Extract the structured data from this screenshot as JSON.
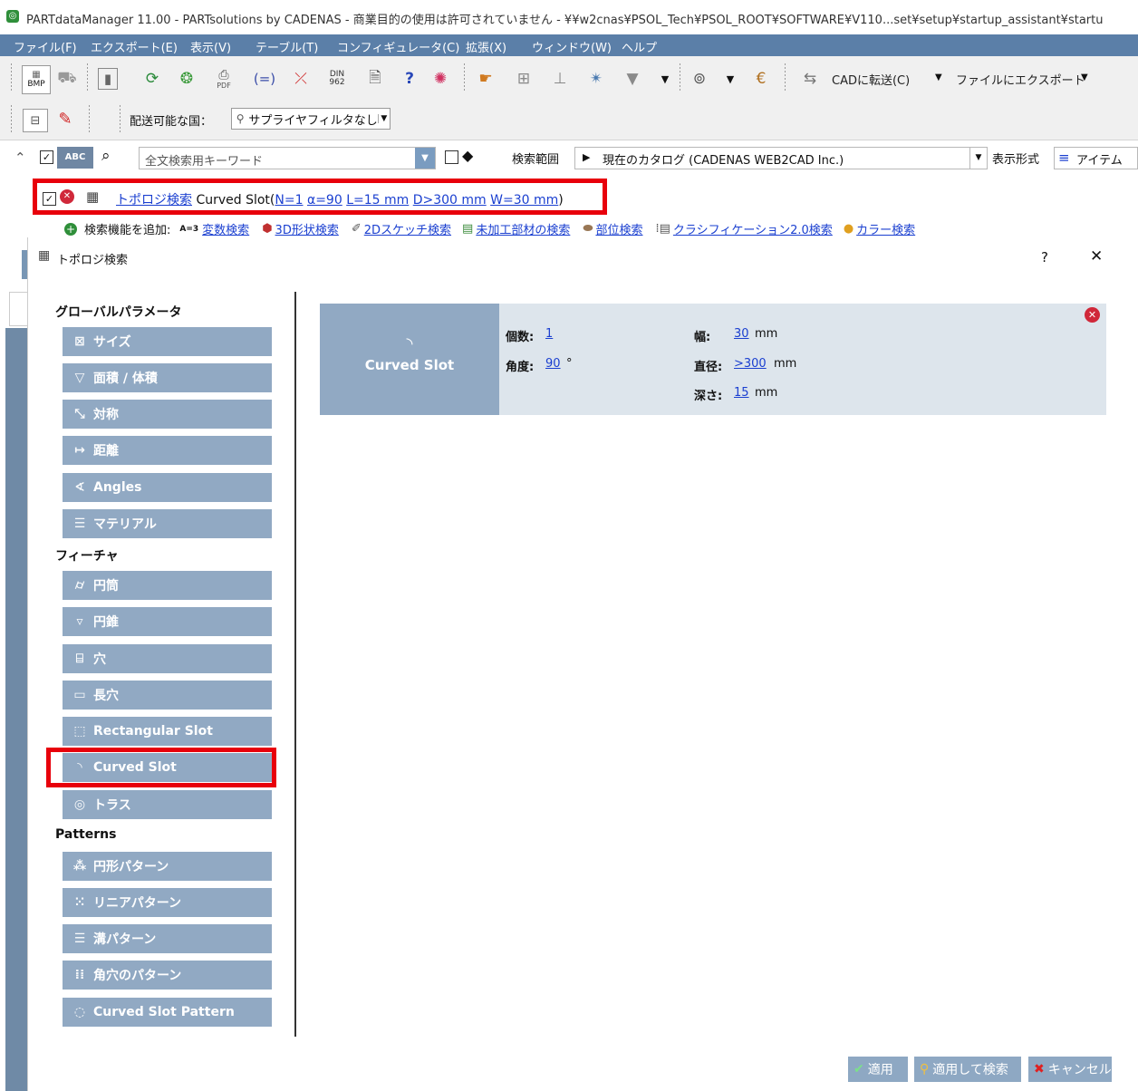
{
  "window": {
    "title": "PARTdataManager 11.00 - PARTsolutions by CADENAS - 商業目的の使用は許可されていません - ¥¥w2cnas¥PSOL_Tech¥PSOL_ROOT¥SOFTWARE¥V110...set¥setup¥startup_assistant¥startu"
  },
  "menu": [
    "ファイル(F)",
    "エクスポート(E)",
    "表示(V)",
    "テーブル(T)",
    "コンフィギュレータ(C)",
    "拡張(X)",
    "ウィンドウ(W)",
    "ヘルプ"
  ],
  "toolbar": {
    "bmp_label": "BMP",
    "pdf_label": "PDF",
    "din_label": "DIN 962",
    "cad_send": "CADに転送(C)",
    "file_export": "ファイルにエクスポート"
  },
  "filterbar": {
    "ship_label": "配送可能な国：",
    "supplier_filter": "サプライヤフィルタなし"
  },
  "search": {
    "abc_label": "ABC",
    "placeholder": "全文検索用キーワード",
    "scope_label": "検索範囲",
    "scope_value": "現在のカタログ (CADENAS WEB2CAD Inc.)",
    "view_label": "表示形式",
    "view_value": "アイテム"
  },
  "active_filter": {
    "link": "トポロジ検索",
    "feature": "Curved Slot(",
    "params": [
      "N=1",
      "α=90",
      "L=15 mm",
      "D>300 mm",
      "W=30 mm"
    ],
    "close": ")"
  },
  "add_search": {
    "label": "検索機能を追加:",
    "var_prefix": "A=3",
    "items": [
      "変数検索",
      "3D形状検索",
      "2Dスケッチ検索",
      "未加工部材の検索",
      "部位検索",
      "クラシフィケーション2.0検索",
      "カラー検索"
    ]
  },
  "dialog": {
    "title": "トポロジ検索",
    "help": "?",
    "close": "✕",
    "global_header": "グローバルパラメータ",
    "global_items": [
      "サイズ",
      "面積 / 体積",
      "対称",
      "距離",
      "Angles",
      "マテリアル"
    ],
    "feature_header": "フィーチャ",
    "feature_items": [
      "円筒",
      "円錐",
      "穴",
      "長穴",
      "Rectangular Slot",
      "Curved Slot",
      "トラス"
    ],
    "pattern_header": "Patterns",
    "pattern_items": [
      "円形パターン",
      "リニアパターン",
      "溝パターン",
      "角穴のパターン",
      "Curved Slot Pattern"
    ],
    "card": {
      "name": "Curved Slot",
      "count_label": "個数:",
      "count_value": "1",
      "angle_label": "角度:",
      "angle_value": "90",
      "angle_unit": "°",
      "width_label": "幅:",
      "width_value": "30",
      "width_unit": "mm",
      "diameter_label": "直径:",
      "diameter_value": ">300",
      "diameter_unit": "mm",
      "depth_label": "深さ:",
      "depth_value": "15",
      "depth_unit": "mm"
    },
    "apply": "適用",
    "apply_search": "適用して検索",
    "cancel": "キャンセル"
  },
  "colors": {
    "menu_bg": "#5b7fa8",
    "nav_btn": "#91a9c3",
    "card_left": "#91a9c3",
    "card_bg": "#dde5ec",
    "highlight": "#e8000b",
    "link": "#1a3fd0"
  }
}
